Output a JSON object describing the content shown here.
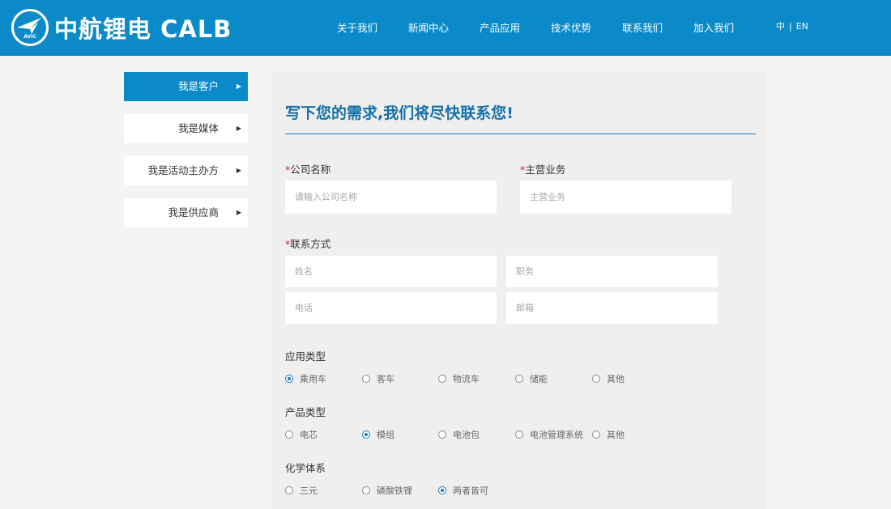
{
  "header": {
    "logo_text": "中航锂电 CALB",
    "logo_badge": "AVIC",
    "nav": [
      "关于我们",
      "新闻中心",
      "产品应用",
      "技术优势",
      "联系我们",
      "加入我们"
    ],
    "lang_cn": "中",
    "lang_sep": "|",
    "lang_en": "EN"
  },
  "sidebar": {
    "items": [
      {
        "label": "我是客户",
        "active": true
      },
      {
        "label": "我是媒体",
        "active": false
      },
      {
        "label": "我是活动主办方",
        "active": false
      },
      {
        "label": "我是供应商",
        "active": false
      }
    ],
    "arrow": "▶"
  },
  "form": {
    "title": "写下您的需求,我们将尽快联系您!",
    "required_mark": "*",
    "company": {
      "label": "公司名称",
      "placeholder": "请输入公司名称"
    },
    "business": {
      "label": "主营业务",
      "placeholder": "主营业务"
    },
    "contact": {
      "label": "联系方式",
      "name_placeholder": "姓名",
      "title_placeholder": "职务",
      "phone_placeholder": "电话",
      "email_placeholder": "邮箱"
    },
    "app_type": {
      "label": "应用类型",
      "options": [
        "乘用车",
        "客车",
        "物流车",
        "储能",
        "其他"
      ],
      "selected": 0
    },
    "product_type": {
      "label": "产品类型",
      "options": [
        "电芯",
        "模组",
        "电池包",
        "电池管理系统",
        "其他"
      ],
      "selected": 1
    },
    "chem": {
      "label": "化学体系",
      "options": [
        "三元",
        "磷酸铁锂",
        "两者皆可"
      ],
      "selected": 2
    }
  },
  "colors": {
    "brand_blue": "#0a8ac9",
    "title_blue": "#1670a8",
    "required_red": "#d0201a"
  }
}
